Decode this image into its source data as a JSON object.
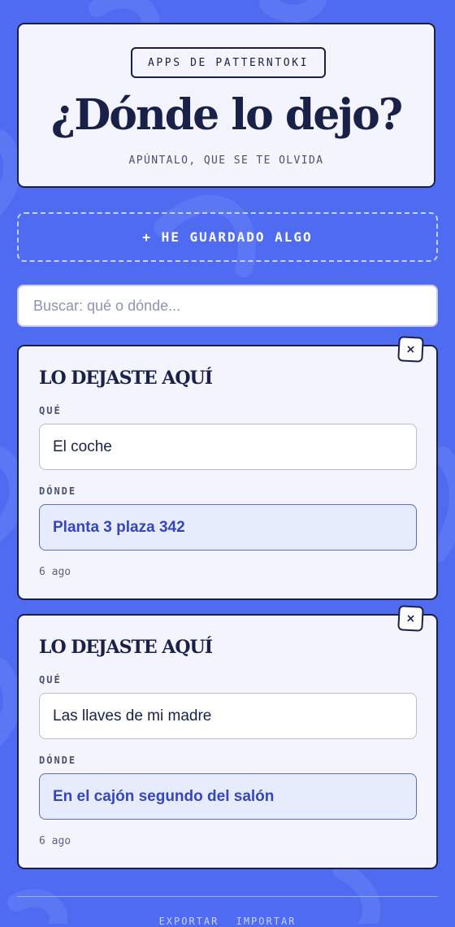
{
  "header": {
    "badge": "APPS DE PATTERNTOKI",
    "title": "¿Dónde lo dejo?",
    "subtitle": "APÚNTALO, QUE SE TE OLVIDA"
  },
  "add_button_label": "+ HE GUARDADO ALGO",
  "search": {
    "placeholder": "Buscar: qué o dónde...",
    "value": ""
  },
  "entries": [
    {
      "heading": "LO DEJASTE AQUÍ",
      "what_label": "QUÉ",
      "what": "El coche",
      "where_label": "DÓNDE",
      "where": "Planta 3 plaza 342",
      "time": "6 ago",
      "close_label": "×"
    },
    {
      "heading": "LO DEJASTE AQUÍ",
      "what_label": "QUÉ",
      "what": "Las llaves de mi madre",
      "where_label": "DÓNDE",
      "where": "En el cajón segundo del salón",
      "time": "6 ago",
      "close_label": "×"
    }
  ],
  "footer": {
    "export_label": "EXPORTAR",
    "import_label": "IMPORTAR"
  },
  "colors": {
    "background": "#4f6bf2",
    "card": "#f3f4fd",
    "ink": "#1a2149",
    "accent": "#3446bd"
  }
}
